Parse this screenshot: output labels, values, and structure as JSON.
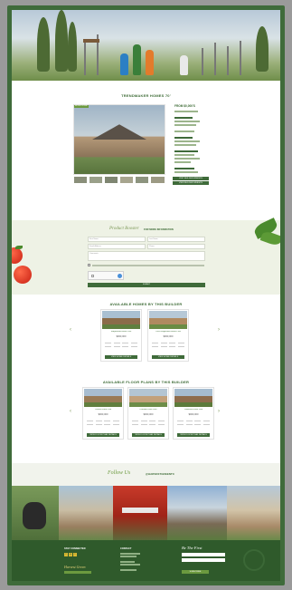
{
  "page": {
    "main_title": "TRENDMAKER HOMES 70'",
    "form_script": "Product Booster",
    "form_heading": "FOR MORE INFORMATION",
    "submit_label": "SUBMIT",
    "available_homes_title": "AVAILABLE HOMES BY THIS BUILDER",
    "floor_plans_title": "AVAILABLE FLOOR PLANS BY THIS BUILDER",
    "follow_script": "Follow Us",
    "follow_handle": "@HARVESTGREENTX"
  },
  "detail": {
    "badge": "MODEL HOME",
    "price": "FROM $0,000'S",
    "buttons": [
      "VISIT BUILDER WEBSITE",
      "VIEW BUILDER WEBSITE"
    ]
  },
  "form": {
    "fields": [
      "First Name",
      "Last Name",
      "Email Address",
      "Phone",
      "Comments"
    ]
  },
  "homes": [
    {
      "title": "Ridgewood Home Plan",
      "price": "$000,000",
      "button": "VIEW HOME DETAILS",
      "colors": [
        "#a9c0d2",
        "#8b6c4a",
        "#5f7f3f"
      ]
    },
    {
      "title": "1000 Ridgewood Home Plan",
      "price": "$000,000",
      "button": "VIEW HOME DETAILS",
      "colors": [
        "#b6c8d6",
        "#b08a60",
        "#6a8c44"
      ]
    }
  ],
  "plans": [
    {
      "title": "Caravel Floor Plan",
      "price": "$000,000",
      "button": "VIEW FLOOR PLAN DETAILS",
      "colors": [
        "#a8bdd0",
        "#9a7a55",
        "#617f3e"
      ]
    },
    {
      "title": "Dresden Floor Plan",
      "price": "$000,000",
      "button": "VIEW FLOOR PLAN DETAILS",
      "colors": [
        "#b3c5d3",
        "#c2a07a",
        "#6d8d48"
      ]
    },
    {
      "title": "Lakemont Floor Plan",
      "price": "$000,000",
      "button": "VIEW FLOOR PLAN DETAILS",
      "colors": [
        "#a5bccf",
        "#8e6c4c",
        "#5c7b3b"
      ]
    }
  ],
  "footer": {
    "stay_connected": "STAY CONNECTED",
    "contact": "CONTACT",
    "script_left": "Harvest Green",
    "script_right": "Be The First",
    "subscribe_label": "SUBSCRIBE"
  },
  "icons": [
    "facebook-icon",
    "instagram-icon",
    "twitter-icon",
    "left-arrow-icon",
    "right-arrow-icon",
    "tomato-icon",
    "leaf-icon"
  ],
  "colors": {
    "brand": "#3f6b3a",
    "accent": "#6c9a3f",
    "frame": "#3f6b3a",
    "gold": "#d9b832"
  }
}
